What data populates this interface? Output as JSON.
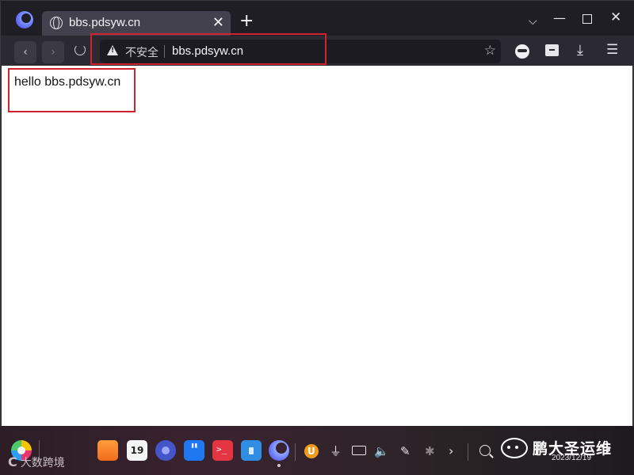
{
  "browser": {
    "tab": {
      "title": "bbs.pdsyw.cn",
      "close_glyph": "✕"
    },
    "new_tab_glyph": "+",
    "window_controls": {
      "chevron": "⌵",
      "minimize": "—",
      "close": "✕"
    },
    "nav": {
      "back_glyph": "‹",
      "forward_glyph": "›"
    },
    "address": {
      "security_label": "不安全",
      "url": "bbs.pdsyw.cn",
      "star_glyph": "☆"
    },
    "toolbar": {
      "download_glyph": "⤓",
      "menu_glyph": "☰"
    },
    "accent": "#d0232e"
  },
  "page": {
    "body_text": "hello bbs.pdsyw.cn"
  },
  "taskbar": {
    "calendar_day": "19",
    "terminal_glyph": ">_",
    "tray": {
      "usb": "⏚",
      "volume": "🔈",
      "pen": "✎",
      "bluetooth": "✱",
      "more": "›",
      "notify": "▾"
    },
    "date": "2023/12/19"
  },
  "watermarks": {
    "left_mark": "C",
    "left_text": "大数跨境",
    "right_text": "鹏大圣运维"
  }
}
